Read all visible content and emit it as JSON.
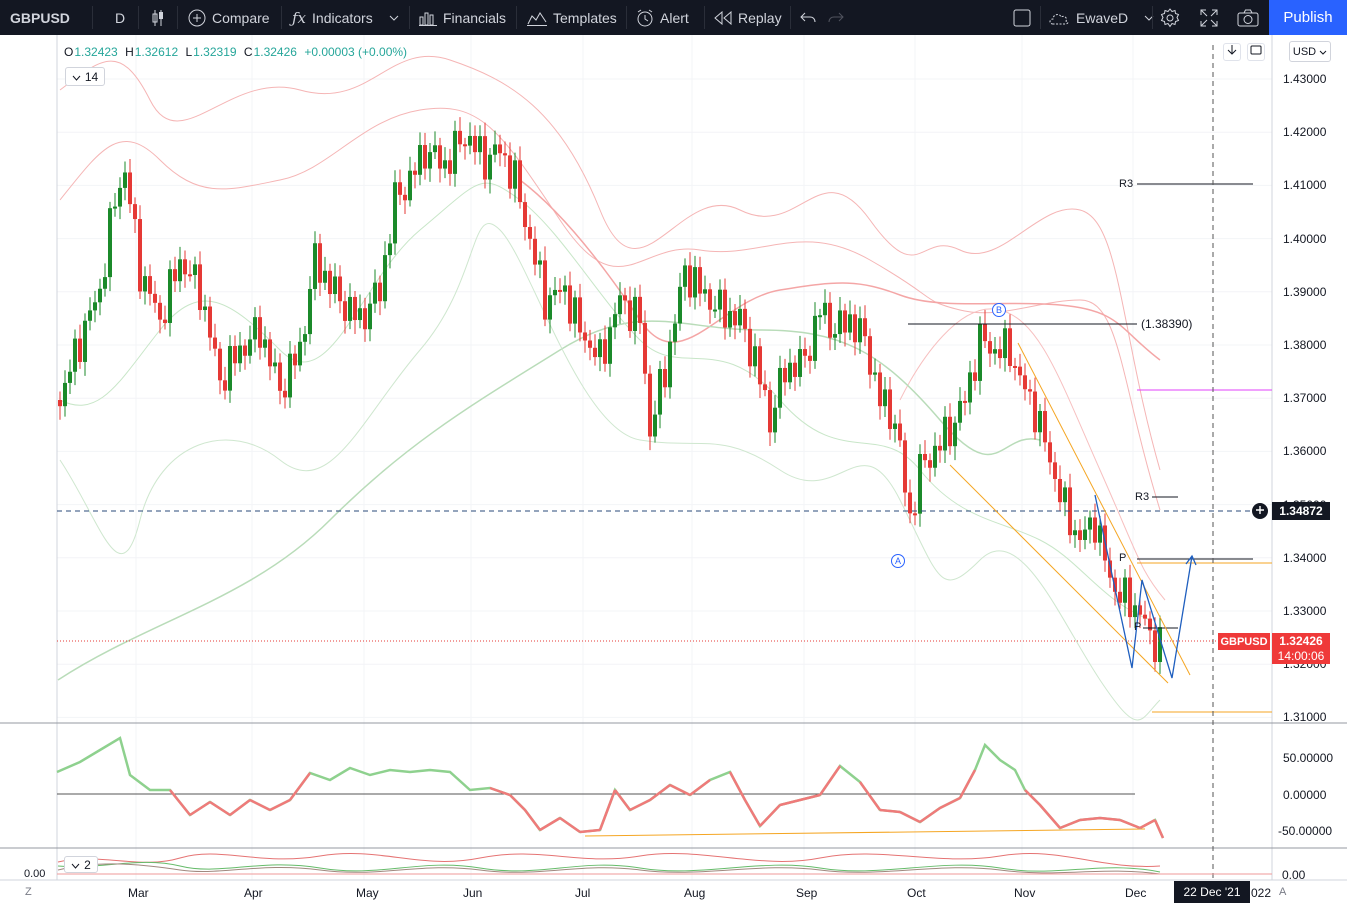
{
  "toolbar": {
    "symbol": "GBPUSD",
    "interval": "D",
    "compare_label": "Compare",
    "indicators_label": "Indicators",
    "financials_label": "Financials",
    "templates_label": "Templates",
    "alert_label": "Alert",
    "replay_label": "Replay",
    "layout_name": "EwaveD",
    "publish_label": "Publish"
  },
  "legend": {
    "o_key": "O",
    "o_val": "1.32423",
    "h_key": "H",
    "h_val": "1.32612",
    "l_key": "L",
    "l_val": "1.32319",
    "c_key": "C",
    "c_val": "1.32426",
    "change": "+0.00003 (+0.00%)",
    "indicator_count": "14",
    "pane2_count": "2"
  },
  "price_axis": {
    "currency": "USD",
    "labels": [
      "1.43000",
      "1.42000",
      "1.41000",
      "1.40000",
      "1.39000",
      "1.38000",
      "1.37000",
      "1.36000",
      "1.35000",
      "1.34000",
      "1.33000",
      "1.32000",
      "1.31000"
    ],
    "crosshair_price": "1.34872",
    "symbol_tag": "GBPUSD",
    "last_price": "1.32426",
    "countdown": "14:00:06"
  },
  "osc_axis": {
    "labels": [
      "50.00000",
      "0.00000",
      "-50.00000"
    ]
  },
  "pane3": {
    "left_value": "0.00",
    "right_value": "0.00"
  },
  "time_axis": {
    "months": [
      "Mar",
      "Apr",
      "May",
      "Jun",
      "Jul",
      "Aug",
      "Sep",
      "Oct",
      "Nov",
      "Dec"
    ],
    "crosshair_date": "22 Dec '21",
    "year_fragment": "022",
    "left_btn": "Z",
    "right_btn": "A"
  },
  "annotations": {
    "wave_a": "A",
    "wave_b": "B",
    "level_label": "(1.38390)",
    "r3_upper": "R3",
    "r3_lower": "R3",
    "pivot_p": "P",
    "pivot_p2": "P"
  },
  "colors": {
    "toolbar_bg": "#131722",
    "accent_blue": "#2962ff",
    "up": "#26a69a",
    "down": "#ef5350",
    "candle_up": "#1b8a2a",
    "candle_down": "#e53935"
  },
  "icons": [
    "candles-icon",
    "compare-plus-icon",
    "fx-icon",
    "financials-icon",
    "templates-icon",
    "alert-clock-icon",
    "replay-icon",
    "undo-icon",
    "redo-icon",
    "fullscreen-box-icon",
    "cloud-icon",
    "gear-icon",
    "expand-icon",
    "camera-icon"
  ]
}
